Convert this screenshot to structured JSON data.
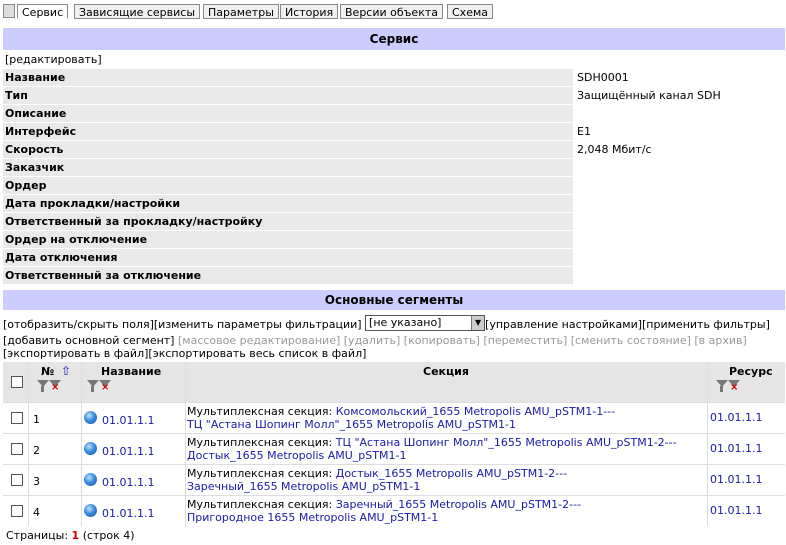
{
  "tabs": [
    "Сервис",
    "Зависящие сервисы",
    "Параметры",
    "История",
    "Версии объекта",
    "Схема"
  ],
  "service": {
    "header": "Сервис",
    "edit_link": "[редактировать]",
    "fields": [
      {
        "label": "Название",
        "value": "SDH0001"
      },
      {
        "label": "Тип",
        "value": "Защищённый канал SDH"
      },
      {
        "label": "Описание",
        "value": ""
      },
      {
        "label": "Интерфейс",
        "value": "E1"
      },
      {
        "label": "Скорость",
        "value": "2,048 Мбит/с"
      },
      {
        "label": "Заказчик",
        "value": ""
      },
      {
        "label": "Ордер",
        "value": ""
      },
      {
        "label": "Дата прокладки/настройки",
        "value": ""
      },
      {
        "label": "Ответственный за прокладку/настройку",
        "value": ""
      },
      {
        "label": "Ордер на отключение",
        "value": ""
      },
      {
        "label": "Дата отключения",
        "value": ""
      },
      {
        "label": "Ответственный за отключение",
        "value": ""
      }
    ]
  },
  "segments": {
    "header": "Основные сегменты",
    "toggle_fields": "[отобразить/скрыть поля]",
    "change_filter": "[изменить параметры фильтрации]",
    "select_value": "[не указано]",
    "manage_settings": "[управление настройками]",
    "apply_filters": "[применить фильтры]",
    "add_segment": "[добавить основной сегмент]",
    "bulk_edit": "[массовое редактирование]",
    "delete": "[удалить]",
    "copy": "[копировать]",
    "move": "[переместить]",
    "change_state": "[сменить состояние]",
    "archive": "[в архив]",
    "export_file": "[экспортировать в файл]",
    "export_all": "[экспортировать весь список в файл]",
    "columns": {
      "num": "№",
      "name": "Название",
      "section": "Секция",
      "resource": "Ресурс"
    },
    "rows": [
      {
        "num": "1",
        "name": "01.01.1.1",
        "prefix": "Мультиплексная секция:",
        "section_a": "Комсомольский_1655 Metropolis AMU_pSTM1-1---",
        "section_b": "ТЦ \"Астана Шопинг Молл\"_1655 Metropolis AMU_pSTM1-1",
        "resource": "01.01.1.1"
      },
      {
        "num": "2",
        "name": "01.01.1.1",
        "prefix": "Мультиплексная секция:",
        "section_a": "ТЦ \"Астана Шопинг Молл\"_1655 Metropolis AMU_pSTM1-2---",
        "section_b": "Достык_1655 Metropolis AMU_pSTM1-1",
        "resource": "01.01.1.1"
      },
      {
        "num": "3",
        "name": "01.01.1.1",
        "prefix": "Мультиплексная секция:",
        "section_a": "Достык_1655 Metropolis AMU_pSTM1-2---",
        "section_b": "Заречный_1655 Metropolis AMU_pSTM1-1",
        "resource": "01.01.1.1"
      },
      {
        "num": "4",
        "name": "01.01.1.1",
        "prefix": "Мультиплексная секция:",
        "section_a": "Заречный_1655 Metropolis AMU_pSTM1-2---",
        "section_b": "Пригородное 1655 Metropolis AMU_pSTM1-1",
        "resource": "01.01.1.1"
      }
    ]
  },
  "pager": {
    "label": "Страницы:",
    "current": "1",
    "count": "(строк 4)"
  }
}
